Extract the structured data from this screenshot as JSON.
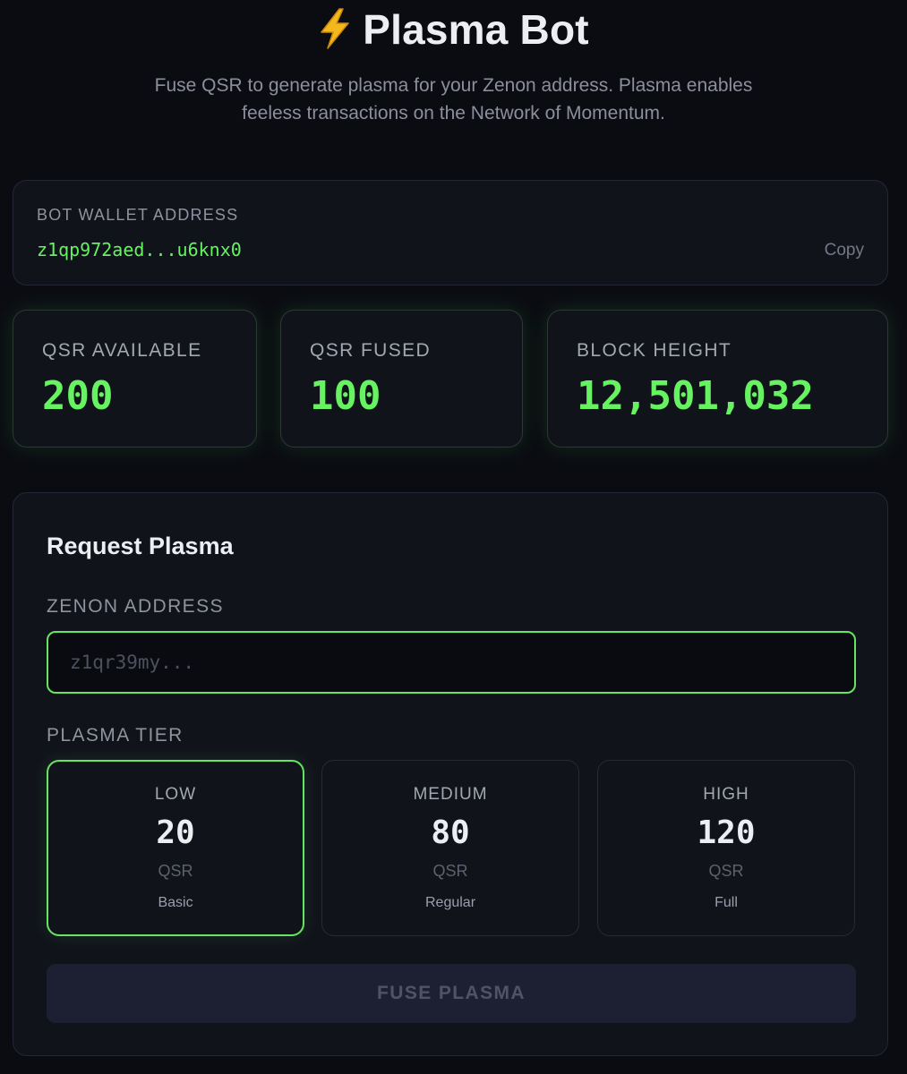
{
  "header": {
    "title": "Plasma Bot",
    "icon": "lightning-bolt-icon",
    "subtitle": "Fuse QSR to generate plasma for your Zenon address. Plasma enables feeless transactions on the Network of Momentum."
  },
  "wallet": {
    "label": "BOT WALLET ADDRESS",
    "address": "z1qp972aed...u6knx0",
    "copy_label": "Copy"
  },
  "stats": [
    {
      "label": "QSR AVAILABLE",
      "value": "200"
    },
    {
      "label": "QSR FUSED",
      "value": "100"
    },
    {
      "label": "BLOCK HEIGHT",
      "value": "12,501,032"
    }
  ],
  "request": {
    "heading": "Request Plasma",
    "address_label": "ZENON ADDRESS",
    "address_value": "",
    "address_placeholder": "z1qr39my...",
    "tier_label": "PLASMA TIER",
    "tiers": [
      {
        "name": "LOW",
        "amount": "20",
        "unit": "QSR",
        "desc": "Basic",
        "selected": true
      },
      {
        "name": "MEDIUM",
        "amount": "80",
        "unit": "QSR",
        "desc": "Regular",
        "selected": false
      },
      {
        "name": "HIGH",
        "amount": "120",
        "unit": "QSR",
        "desc": "Full",
        "selected": false
      }
    ],
    "submit_label": "FUSE PLASMA"
  },
  "colors": {
    "accent_green": "#66f261",
    "background": "#0b0c12",
    "card": "#11131b"
  }
}
